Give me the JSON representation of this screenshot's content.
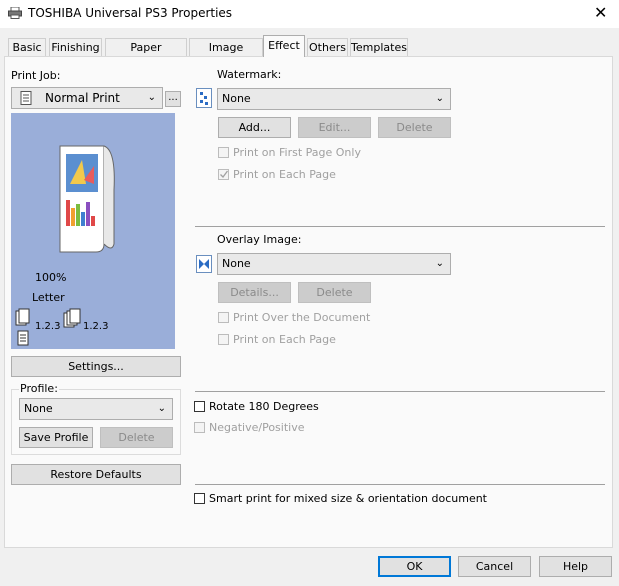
{
  "window": {
    "title": "TOSHIBA Universal PS3 Properties",
    "close_glyph": "✕",
    "icon": "printer-icon"
  },
  "tabs": [
    {
      "label": "Basic"
    },
    {
      "label": "Finishing"
    },
    {
      "label": "Paper Handling"
    },
    {
      "label": "Image Quality"
    },
    {
      "label": "Effect",
      "active": true
    },
    {
      "label": "Others"
    },
    {
      "label": "Templates"
    }
  ],
  "left": {
    "print_job_label": "Print Job:",
    "print_job_value": "Normal Print",
    "more_button": "...",
    "preview": {
      "zoom": "100%",
      "paper": "Letter",
      "collate_a": "1.2.3",
      "collate_b": "1.2.3"
    },
    "settings_button": "Settings...",
    "profile_label": "Profile:",
    "profile_value": "None",
    "save_profile_button": "Save Profile",
    "delete_button": "Delete",
    "restore_defaults_button": "Restore Defaults"
  },
  "watermark": {
    "label": "Watermark:",
    "value": "None",
    "add_button": "Add...",
    "edit_button": "Edit...",
    "delete_button": "Delete",
    "first_page_only": "Print on First Page Only",
    "each_page": "Print on Each Page",
    "each_page_checked": true
  },
  "overlay": {
    "label": "Overlay Image:",
    "value": "None",
    "details_button": "Details...",
    "delete_button": "Delete",
    "over_document": "Print Over the Document",
    "each_page": "Print on Each Page"
  },
  "options": {
    "rotate": "Rotate 180 Degrees",
    "negative": "Negative/Positive",
    "smart_print": "Smart print for mixed size & orientation document"
  },
  "footer": {
    "ok": "OK",
    "cancel": "Cancel",
    "help": "Help"
  },
  "colors": {
    "preview_bg": "#9aaed9",
    "focus_border": "#0078d7"
  }
}
